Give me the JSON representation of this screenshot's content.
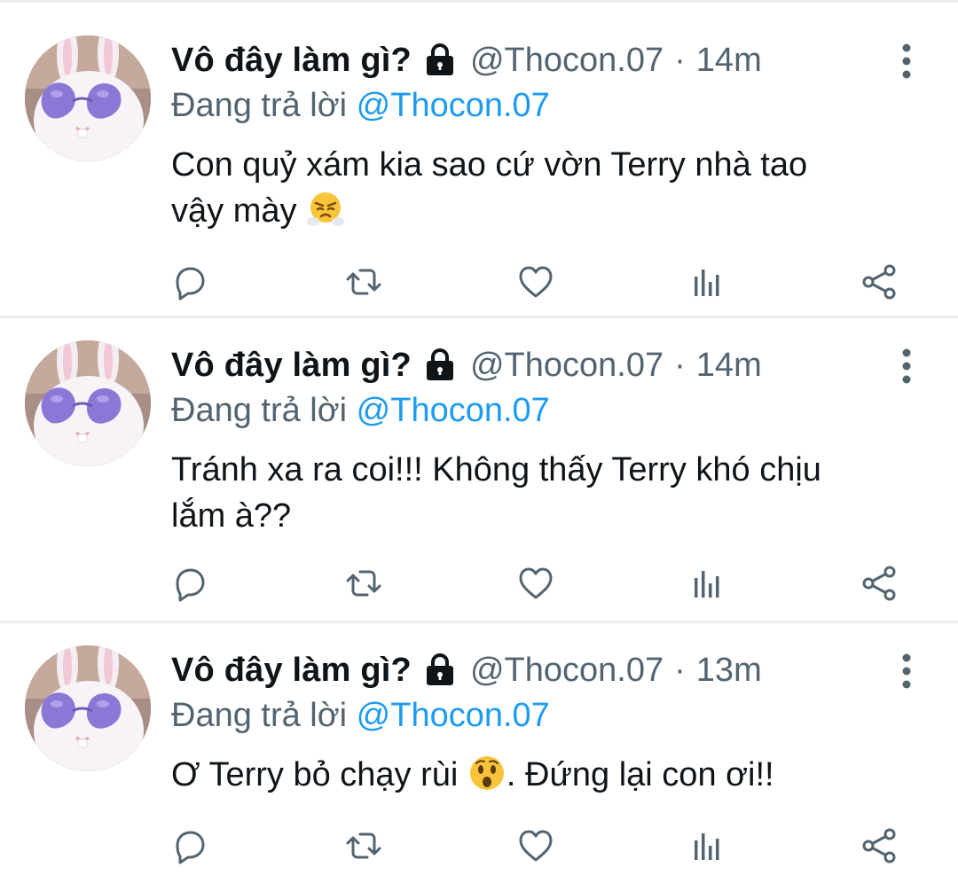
{
  "colors": {
    "text": "#0f1419",
    "muted": "#536471",
    "link": "#1d9bf0",
    "divider": "#ebeef0"
  },
  "icons": {
    "protected": "lock-icon",
    "more": "more-vertical-icon",
    "reply": "reply-icon",
    "retweet": "retweet-icon",
    "like": "heart-icon",
    "analytics": "analytics-icon",
    "share": "share-icon"
  },
  "tweets": [
    {
      "display_name": "Vô đây làm gì?",
      "handle": "@Thocon.07",
      "separator": "·",
      "time": "14m",
      "reply_prefix": "Đang trả lời",
      "reply_to": "@Thocon.07",
      "body_1": "Con quỷ xám kia sao cứ vờn Terry nhà tao",
      "body_2": "vậy mày",
      "body_3": "",
      "emoji": "face-with-steam-emoji"
    },
    {
      "display_name": "Vô đây làm gì?",
      "handle": "@Thocon.07",
      "separator": "·",
      "time": "14m",
      "reply_prefix": "Đang trả lời",
      "reply_to": "@Thocon.07",
      "body_1": "Tránh xa ra coi!!! Không thấy Terry khó chịu",
      "body_2": "lắm à??",
      "body_3": "",
      "emoji": ""
    },
    {
      "display_name": "Vô đây làm gì?",
      "handle": "@Thocon.07",
      "separator": "·",
      "time": "13m",
      "reply_prefix": "Đang trả lời",
      "reply_to": "@Thocon.07",
      "body_1": "Ơ Terry bỏ chạy rùi",
      "body_2": "",
      "body_3": ". Đứng lại con ơi!!",
      "emoji": "astonished-face-emoji"
    }
  ]
}
